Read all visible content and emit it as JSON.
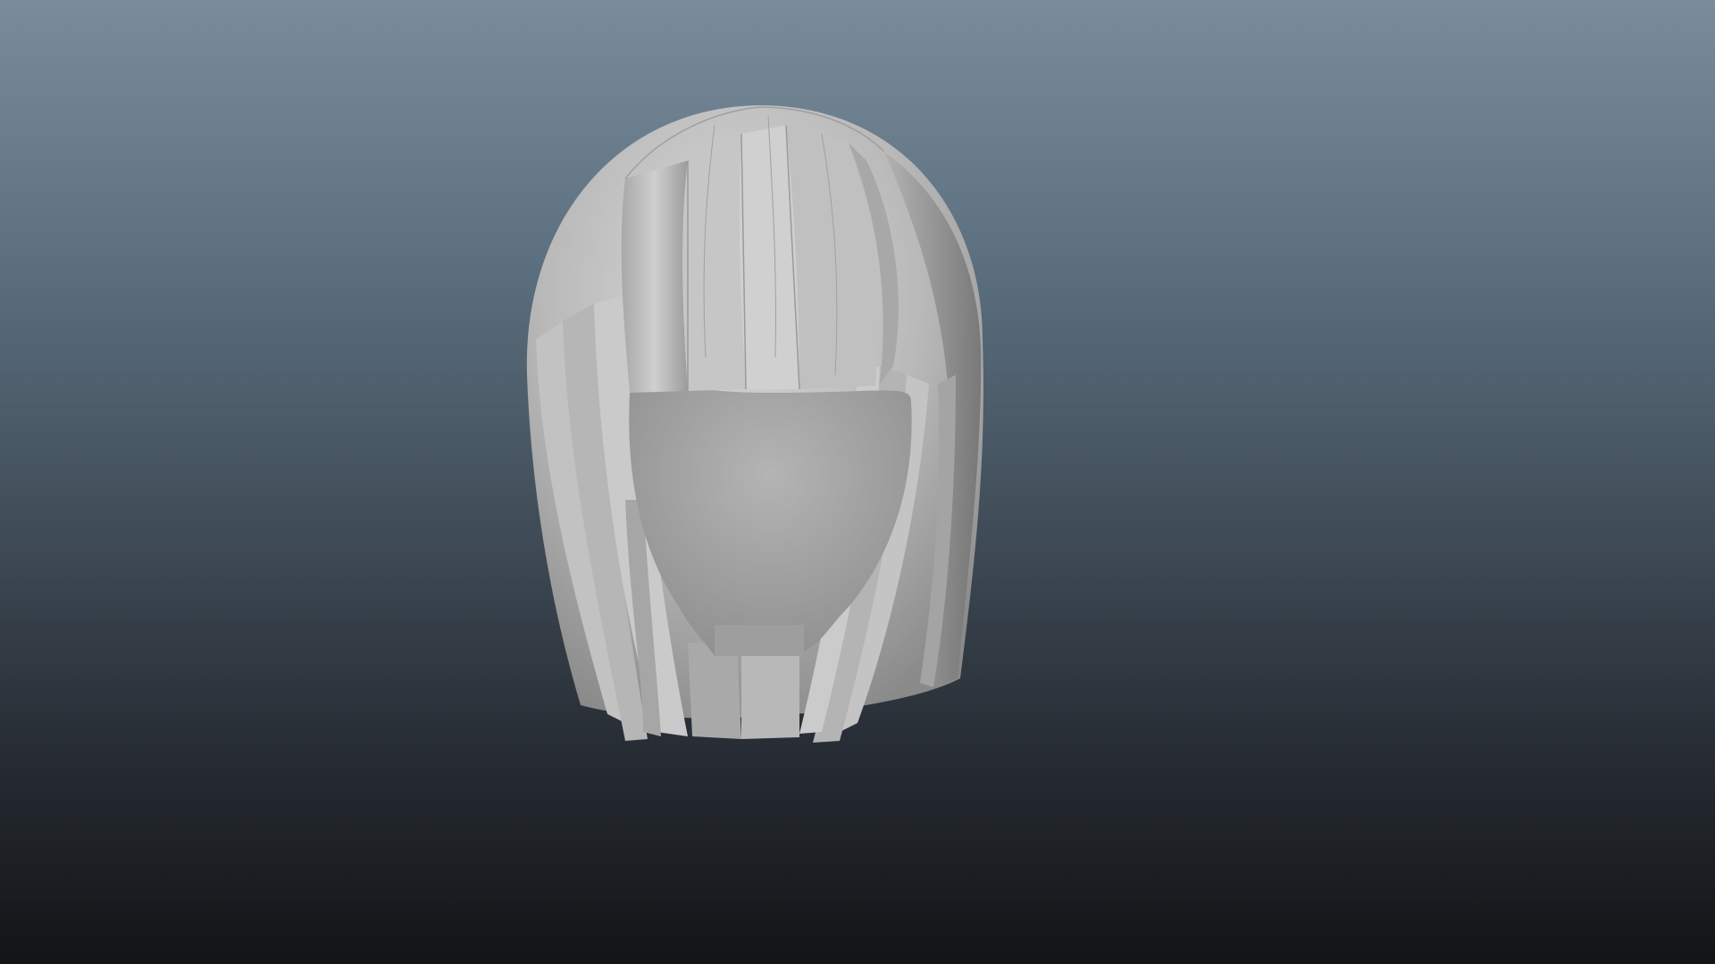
{
  "viewport": {
    "background_top": "#7a8c9a",
    "background_bottom": "#121416"
  },
  "model": {
    "name": "hair-mesh",
    "description_type": "3d-shaded-model",
    "hair_color": "#bcbcbc",
    "face_color": "#a9a9a9"
  }
}
